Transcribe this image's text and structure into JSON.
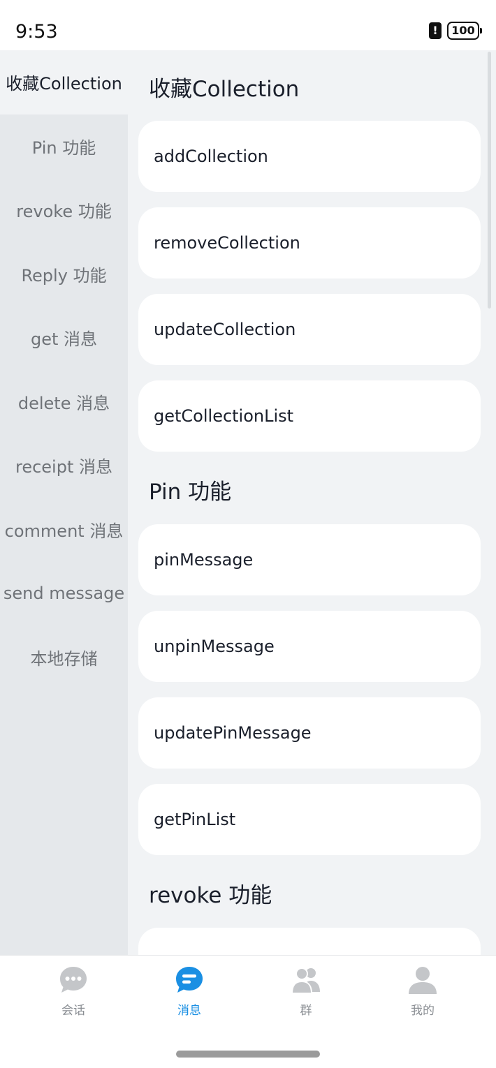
{
  "status_bar": {
    "time": "9:53",
    "alert_glyph": "!",
    "battery_level": "100"
  },
  "sidebar": {
    "items": [
      {
        "label": "收藏Collection",
        "active": true
      },
      {
        "label": "Pin 功能",
        "active": false
      },
      {
        "label": "revoke 功能",
        "active": false
      },
      {
        "label": "Reply 功能",
        "active": false
      },
      {
        "label": "get 消息",
        "active": false
      },
      {
        "label": "delete 消息",
        "active": false
      },
      {
        "label": "receipt 消息",
        "active": false
      },
      {
        "label": "comment 消息",
        "active": false
      },
      {
        "label": "send message",
        "active": false
      },
      {
        "label": "本地存储",
        "active": false
      }
    ]
  },
  "sections": [
    {
      "title": "收藏Collection",
      "items": [
        "addCollection",
        "removeCollection",
        "updateCollection",
        "getCollectionList"
      ]
    },
    {
      "title": "Pin 功能",
      "items": [
        "pinMessage",
        "unpinMessage",
        "updatePinMessage",
        "getPinList"
      ]
    },
    {
      "title": "revoke 功能",
      "items": [
        ""
      ]
    }
  ],
  "tabbar": {
    "tabs": [
      {
        "label": "会话",
        "icon": "chat-bubble-icon",
        "active": false
      },
      {
        "label": "消息",
        "icon": "message-icon",
        "active": true
      },
      {
        "label": "群",
        "icon": "group-icon",
        "active": false
      },
      {
        "label": "我的",
        "icon": "person-icon",
        "active": false
      }
    ]
  },
  "colors": {
    "accent": "#1a8fe3",
    "inactive_icon": "#c4c6c9",
    "sidebar_bg": "#e5e8eb",
    "content_bg": "#f1f3f5"
  }
}
